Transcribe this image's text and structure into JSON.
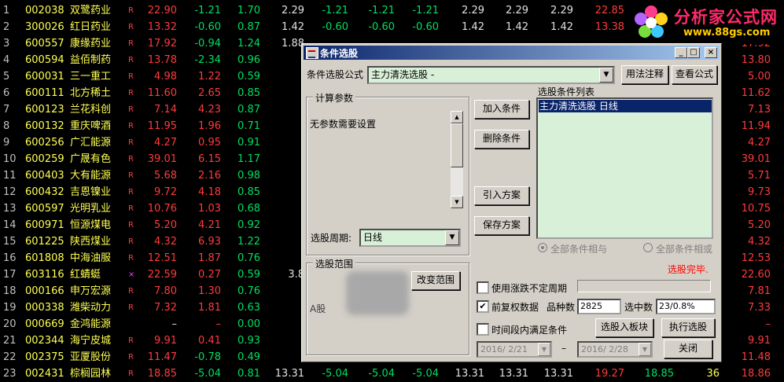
{
  "logo": {
    "text": "分析家公式网",
    "url": "www.88gs.com"
  },
  "rows": [
    {
      "i": "1",
      "code": "002038",
      "name": "双鹭药业",
      "flag": "R",
      "price": "22.90",
      "chg": "-1.21",
      "pct": "1.70",
      "c5": "2.29",
      "c6": "-1.21",
      "c7": "-1.21",
      "c8": "-1.21",
      "c9": "2.29",
      "c10": "2.29",
      "c11": "2.29",
      "c12": "22.85",
      "c14": "",
      "c15": ""
    },
    {
      "i": "2",
      "code": "300026",
      "name": "红日药业",
      "flag": "R",
      "price": "13.32",
      "chg": "-0.60",
      "pct": "0.87",
      "c5": "1.42",
      "c6": "-0.60",
      "c7": "-0.60",
      "c8": "-0.60",
      "c9": "1.42",
      "c10": "1.42",
      "c11": "1.42",
      "c12": "13.38",
      "c14": "",
      "c15": ""
    },
    {
      "i": "3",
      "code": "600557",
      "name": "康缘药业",
      "flag": "R",
      "price": "17.92",
      "chg": "-0.94",
      "pct": "1.24",
      "c5": "1.88",
      "c6": "",
      "c7": "",
      "c8": "",
      "c9": "",
      "c10": "",
      "c11": "",
      "c12": "",
      "c14": "",
      "c15": "17.92"
    },
    {
      "i": "4",
      "code": "600594",
      "name": "益佰制药",
      "flag": "R",
      "price": "13.78",
      "chg": "-2.34",
      "pct": "0.96",
      "c5": "",
      "c6": "",
      "c7": "",
      "c8": "",
      "c9": "",
      "c10": "",
      "c11": "",
      "c12": "",
      "c14": "",
      "c15": "13.80"
    },
    {
      "i": "5",
      "code": "600031",
      "name": "三一重工",
      "flag": "R",
      "price": "4.98",
      "chg": "1.22",
      "pct": "0.59",
      "c5": "",
      "c6": "",
      "c7": "",
      "c8": "",
      "c9": "",
      "c10": "",
      "c11": "",
      "c12": "",
      "c14": "",
      "c15": "5.00"
    },
    {
      "i": "6",
      "code": "600111",
      "name": "北方稀土",
      "flag": "R",
      "price": "11.60",
      "chg": "2.65",
      "pct": "0.85",
      "c5": "",
      "c6": "",
      "c7": "",
      "c8": "",
      "c9": "",
      "c10": "",
      "c11": "",
      "c12": "",
      "c14": "",
      "c15": "11.62"
    },
    {
      "i": "7",
      "code": "600123",
      "name": "兰花科创",
      "flag": "R",
      "price": "7.14",
      "chg": "4.23",
      "pct": "0.87",
      "c5": "",
      "c6": "",
      "c7": "",
      "c8": "",
      "c9": "",
      "c10": "",
      "c11": "",
      "c12": "",
      "c14": "",
      "c15": "7.13"
    },
    {
      "i": "8",
      "code": "600132",
      "name": "重庆啤酒",
      "flag": "R",
      "price": "11.95",
      "chg": "1.96",
      "pct": "0.71",
      "c5": "",
      "c6": "",
      "c7": "",
      "c8": "",
      "c9": "",
      "c10": "",
      "c11": "",
      "c12": "",
      "c14": "",
      "c15": "11.94"
    },
    {
      "i": "9",
      "code": "600256",
      "name": "广汇能源",
      "flag": "R",
      "price": "4.27",
      "chg": "0.95",
      "pct": "0.91",
      "c5": "",
      "c6": "",
      "c7": "",
      "c8": "",
      "c9": "",
      "c10": "",
      "c11": "",
      "c12": "",
      "c14": "",
      "c15": "4.27"
    },
    {
      "i": "10",
      "code": "600259",
      "name": "广晟有色",
      "flag": "R",
      "price": "39.01",
      "chg": "6.15",
      "pct": "1.17",
      "c5": "",
      "c6": "",
      "c7": "",
      "c8": "",
      "c9": "",
      "c10": "",
      "c11": "",
      "c12": "",
      "c14": "",
      "c15": "39.01"
    },
    {
      "i": "11",
      "code": "600403",
      "name": "大有能源",
      "flag": "R",
      "price": "5.68",
      "chg": "2.16",
      "pct": "0.98",
      "c5": "",
      "c6": "",
      "c7": "",
      "c8": "",
      "c9": "",
      "c10": "",
      "c11": "",
      "c12": "",
      "c14": "",
      "c15": "5.71"
    },
    {
      "i": "12",
      "code": "600432",
      "name": "吉恩镍业",
      "flag": "R",
      "price": "9.72",
      "chg": "4.18",
      "pct": "0.85",
      "c5": "",
      "c6": "",
      "c7": "",
      "c8": "",
      "c9": "",
      "c10": "",
      "c11": "",
      "c12": "",
      "c14": "",
      "c15": "9.73"
    },
    {
      "i": "13",
      "code": "600597",
      "name": "光明乳业",
      "flag": "R",
      "price": "10.76",
      "chg": "1.03",
      "pct": "0.68",
      "c5": "",
      "c6": "",
      "c7": "",
      "c8": "",
      "c9": "",
      "c10": "",
      "c11": "",
      "c12": "",
      "c14": "",
      "c15": "10.75"
    },
    {
      "i": "14",
      "code": "600971",
      "name": "恒源煤电",
      "flag": "R",
      "price": "5.20",
      "chg": "4.21",
      "pct": "0.92",
      "c5": "",
      "c6": "",
      "c7": "",
      "c8": "",
      "c9": "",
      "c10": "",
      "c11": "",
      "c12": "",
      "c14": "",
      "c15": "5.20"
    },
    {
      "i": "15",
      "code": "601225",
      "name": "陕西煤业",
      "flag": "R",
      "price": "4.32",
      "chg": "6.93",
      "pct": "1.22",
      "c5": "",
      "c6": "",
      "c7": "",
      "c8": "",
      "c9": "",
      "c10": "",
      "c11": "",
      "c12": "",
      "c14": "",
      "c15": "4.32"
    },
    {
      "i": "16",
      "code": "601808",
      "name": "中海油服",
      "flag": "R",
      "price": "12.51",
      "chg": "1.87",
      "pct": "0.76",
      "c5": "",
      "c6": "",
      "c7": "",
      "c8": "",
      "c9": "",
      "c10": "",
      "c11": "",
      "c12": "",
      "c14": "",
      "c15": "12.53"
    },
    {
      "i": "17",
      "code": "603116",
      "name": "红蜻蜓",
      "flag": "×",
      "price": "22.59",
      "chg": "0.27",
      "pct": "0.59",
      "c5": "3.8",
      "c6": "",
      "c7": "",
      "c8": "",
      "c9": "",
      "c10": "",
      "c11": "",
      "c12": "",
      "c14": "",
      "c15": "22.60"
    },
    {
      "i": "18",
      "code": "000166",
      "name": "申万宏源",
      "flag": "R",
      "price": "7.80",
      "chg": "1.30",
      "pct": "0.76",
      "c5": "",
      "c6": "",
      "c7": "",
      "c8": "",
      "c9": "",
      "c10": "",
      "c11": "",
      "c12": "",
      "c14": "",
      "c15": "7.81"
    },
    {
      "i": "19",
      "code": "000338",
      "name": "潍柴动力",
      "flag": "R",
      "price": "7.32",
      "chg": "1.81",
      "pct": "0.63",
      "c5": "",
      "c6": "",
      "c7": "",
      "c8": "",
      "c9": "",
      "c10": "",
      "c11": "",
      "c12": "",
      "c14": "",
      "c15": "7.33"
    },
    {
      "i": "20",
      "code": "000669",
      "name": "金鸿能源",
      "flag": "",
      "price": "–",
      "chg": "–",
      "pct": "0.00",
      "c5": "",
      "c6": "",
      "c7": "",
      "c8": "",
      "c9": "",
      "c10": "",
      "c11": "",
      "c12": "",
      "c14": "",
      "c15": "–"
    },
    {
      "i": "21",
      "code": "002344",
      "name": "海宁皮城",
      "flag": "R",
      "price": "9.91",
      "chg": "0.41",
      "pct": "0.93",
      "c5": "",
      "c6": "",
      "c7": "",
      "c8": "",
      "c9": "",
      "c10": "",
      "c11": "",
      "c12": "",
      "c14": "",
      "c15": "9.91"
    },
    {
      "i": "22",
      "code": "002375",
      "name": "亚厦股份",
      "flag": "R",
      "price": "11.47",
      "chg": "-0.78",
      "pct": "0.49",
      "c5": "",
      "c6": "",
      "c7": "",
      "c8": "",
      "c9": "",
      "c10": "",
      "c11": "",
      "c12": "",
      "c14": "",
      "c15": "11.48"
    },
    {
      "i": "23",
      "code": "002431",
      "name": "棕榈园林",
      "flag": "R",
      "price": "18.85",
      "chg": "-5.04",
      "pct": "0.81",
      "c5": "13.31",
      "c6": "-5.04",
      "c7": "-5.04",
      "c8": "-5.04",
      "c9": "13.31",
      "c10": "13.31",
      "c11": "13.31",
      "c12": "19.27",
      "c13": "18.85",
      "c14": "36",
      "c15": "18.86"
    }
  ],
  "dialog": {
    "title": "条件选股",
    "btn_min": "_",
    "btn_max": "□",
    "btn_close": "×",
    "formula_label": "条件选股公式",
    "formula_value": "主力清洗选股  -",
    "usage_btn": "用法注释",
    "view_btn": "查看公式",
    "params_group": "计算参数",
    "params_text": "无参数需要设置",
    "period_label": "选股周期:",
    "period_value": "日线",
    "range_group": "选股范围",
    "change_range_btn": "改变范围",
    "range_hint": "A股",
    "add_btn": "加入条件",
    "del_btn": "删除条件",
    "import_btn": "引入方案",
    "save_btn": "保存方案",
    "list_label": "选股条件列表",
    "list_items": [
      "主力清洗选股   日线"
    ],
    "radio_and": "全部条件相与",
    "radio_or": "全部条件相或",
    "status": "选股完毕.",
    "use_period_label": "使用涨跌不定周期",
    "adjust_label": "前复权数据",
    "count_label": "品种数",
    "count_value": "2825",
    "selected_label": "选中数",
    "selected_value": "23/0.8%",
    "time_label": "时间段内满足条件",
    "to_block_btn": "选股入板块",
    "execute_btn": "执行选股",
    "close_btn": "关闭",
    "date_from": "2016/ 2/21",
    "date_sep": "–",
    "date_to": "2016/ 2/28",
    "checked_mark": "✔"
  }
}
